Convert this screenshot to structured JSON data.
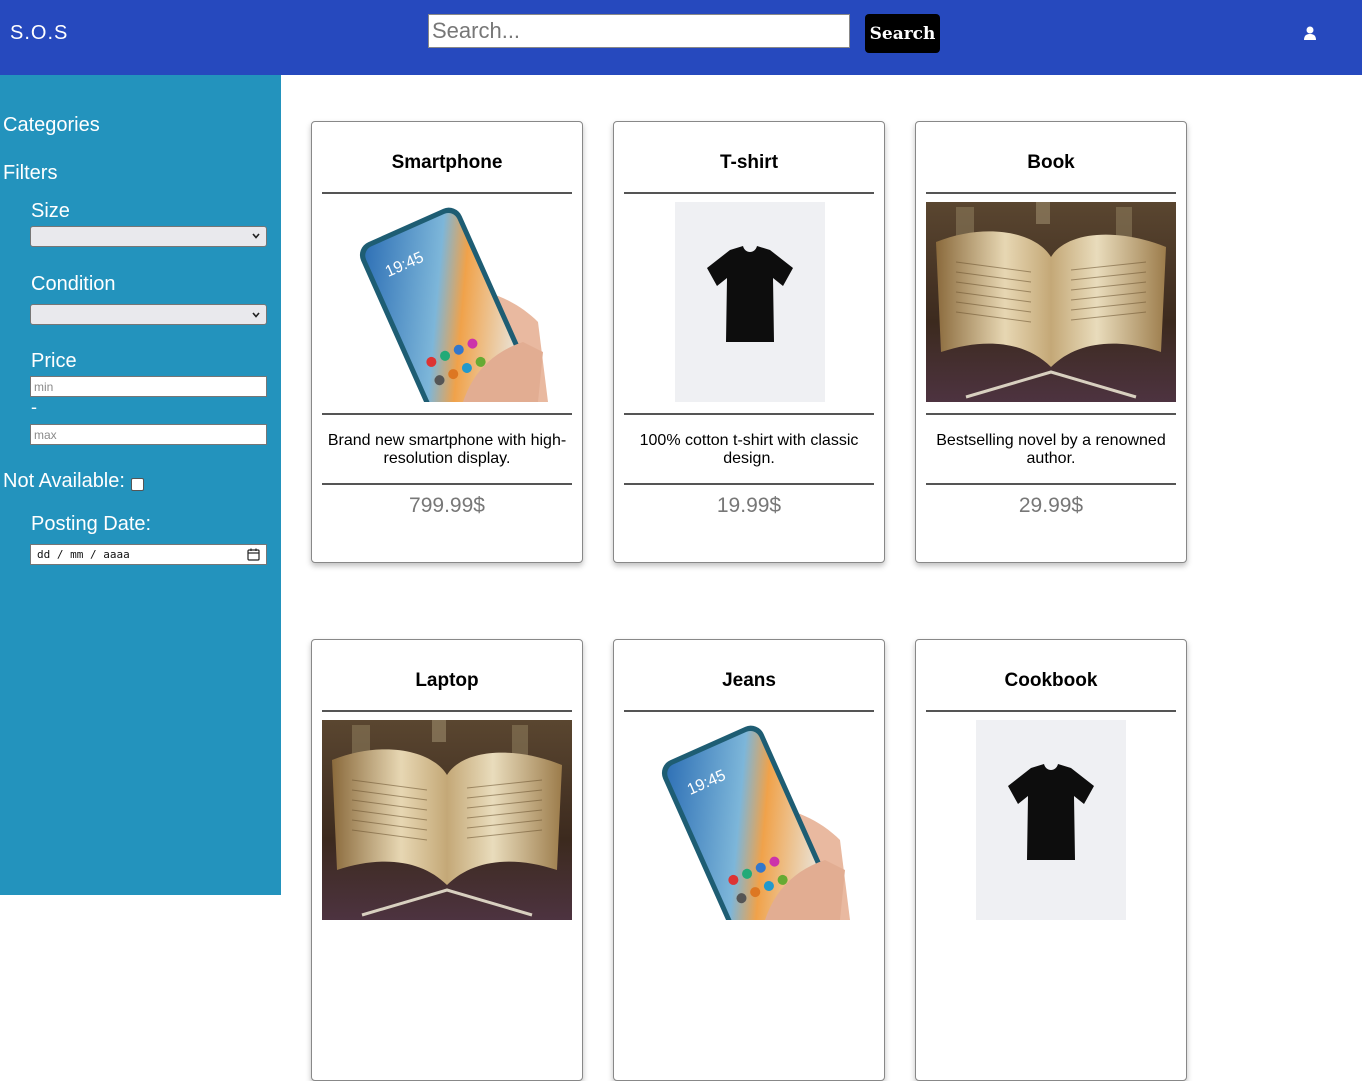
{
  "header": {
    "brand": "S.O.S",
    "search_placeholder": "Search...",
    "search_button": "Search",
    "accent": "#2649be"
  },
  "sidebar": {
    "background": "#2393bd",
    "categories_label": "Categories",
    "filters_label": "Filters",
    "size_label": "Size",
    "condition_label": "Condition",
    "price_label": "Price",
    "min_placeholder": "min",
    "price_separator": "-",
    "max_placeholder": "max",
    "not_available_label": "Not Available:",
    "posting_date_label": "Posting Date:",
    "date_placeholder": "dd / mm / aaaa"
  },
  "products": [
    {
      "title": "Smartphone",
      "image": "smartphone-photo",
      "description": "Brand new smartphone with high-resolution display.",
      "price": "799.99$"
    },
    {
      "title": "T-shirt",
      "image": "tshirt-photo",
      "description": "100% cotton t-shirt with classic design.",
      "price": "19.99$"
    },
    {
      "title": "Book",
      "image": "book-photo",
      "description": "Bestselling novel by a renowned author.",
      "price": "29.99$"
    },
    {
      "title": "Laptop",
      "image": "book-photo"
    },
    {
      "title": "Jeans",
      "image": "smartphone-photo"
    },
    {
      "title": "Cookbook",
      "image": "tshirt-photo"
    }
  ]
}
